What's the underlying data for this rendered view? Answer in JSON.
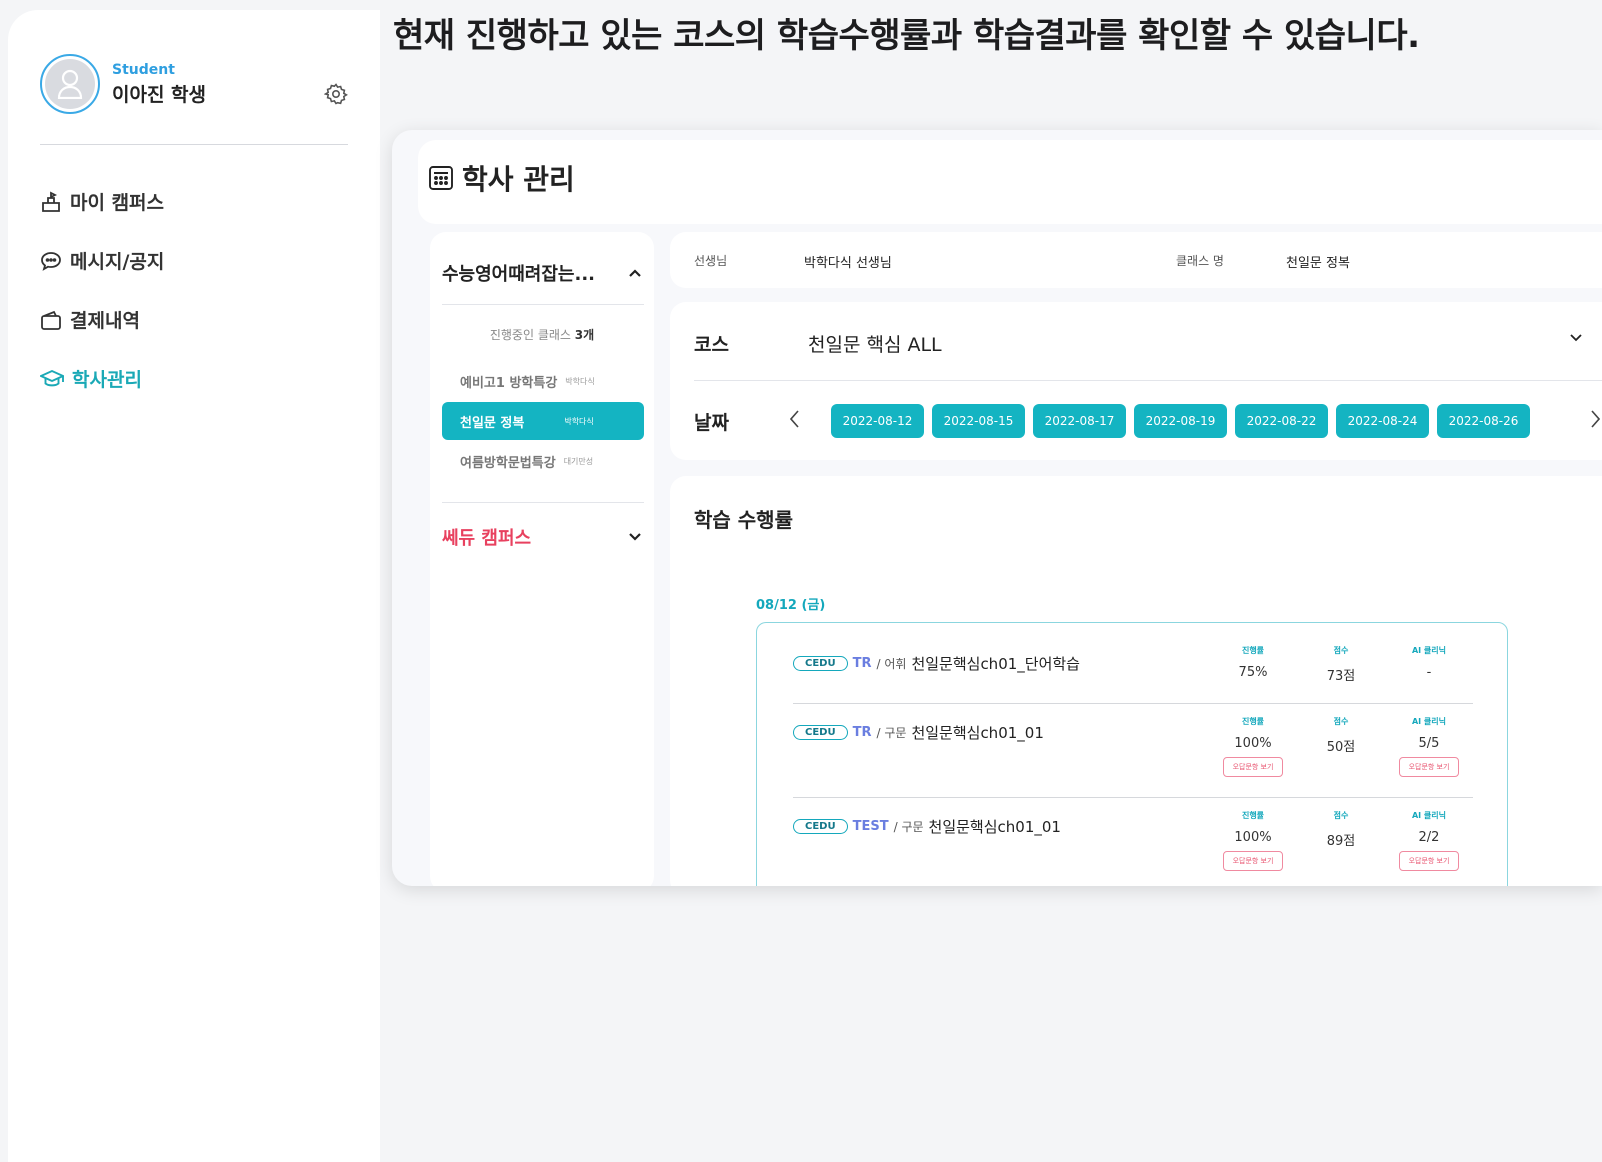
{
  "headline": "현재 진행하고 있는 코스의 학습수행률과 학습결과를 확인할 수 있습니다.",
  "profile": {
    "role": "Student",
    "name": "이아진 학생"
  },
  "nav": [
    {
      "label": "마이 캠퍼스",
      "icon": "campus-icon"
    },
    {
      "label": "메시지/공지",
      "icon": "message-icon"
    },
    {
      "label": "결제내역",
      "icon": "wallet-icon"
    },
    {
      "label": "학사관리",
      "icon": "graduation-cap-icon"
    }
  ],
  "page_title": "학사 관리",
  "class_panel": {
    "academy": "수능영어때려잡는...",
    "count_prefix": "진행중인 클래스 ",
    "count": "3개",
    "classes": [
      {
        "name": "예비고1 방학특강",
        "teacher": "박학다식"
      },
      {
        "name": "천일문 정복",
        "teacher": "박학다식"
      },
      {
        "name": "여름방학문법특강",
        "teacher": "대기만성"
      }
    ],
    "campus": "쎄듀 캠퍼스"
  },
  "info": {
    "teacher_label": "선생님",
    "teacher": "박학다식 선생님",
    "class_label": "클래스 명",
    "class_name": "천일문 정복"
  },
  "course": {
    "label": "코스",
    "value": "천일문 핵심 ALL"
  },
  "dates": {
    "label": "날짜",
    "items": [
      "2022-08-12",
      "2022-08-15",
      "2022-08-17",
      "2022-08-19",
      "2022-08-22",
      "2022-08-24",
      "2022-08-26"
    ]
  },
  "progress": {
    "title": "학습 수행률",
    "day": "08/12 (금)",
    "lessons": [
      {
        "badge": "CEDU",
        "type": "TR",
        "category": "어휘",
        "title": "천일문핵심ch01_단어학습",
        "progress_label": "진행률",
        "progress": "75%",
        "score_label": "점수",
        "score": "73점",
        "clinic_label": "AI 클리닉",
        "clinic": "-",
        "wrong_button": null
      },
      {
        "badge": "CEDU",
        "type": "TR",
        "category": "구문",
        "title": "천일문핵심ch01_01",
        "progress_label": "진행률",
        "progress": "100%",
        "score_label": "점수",
        "score": "50점",
        "clinic_label": "AI 클리닉",
        "clinic": "5/5",
        "wrong_button": "오답문항 보기"
      },
      {
        "badge": "CEDU",
        "type": "TEST",
        "category": "구문",
        "title": "천일문핵심ch01_01",
        "progress_label": "진행률",
        "progress": "100%",
        "score_label": "점수",
        "score": "89점",
        "clinic_label": "AI 클리닉",
        "clinic": "2/2",
        "wrong_button": "오답문항 보기"
      }
    ]
  },
  "colors": {
    "accent": "#14b4c2",
    "campus": "#e8415f",
    "role": "#2f9fe0"
  }
}
